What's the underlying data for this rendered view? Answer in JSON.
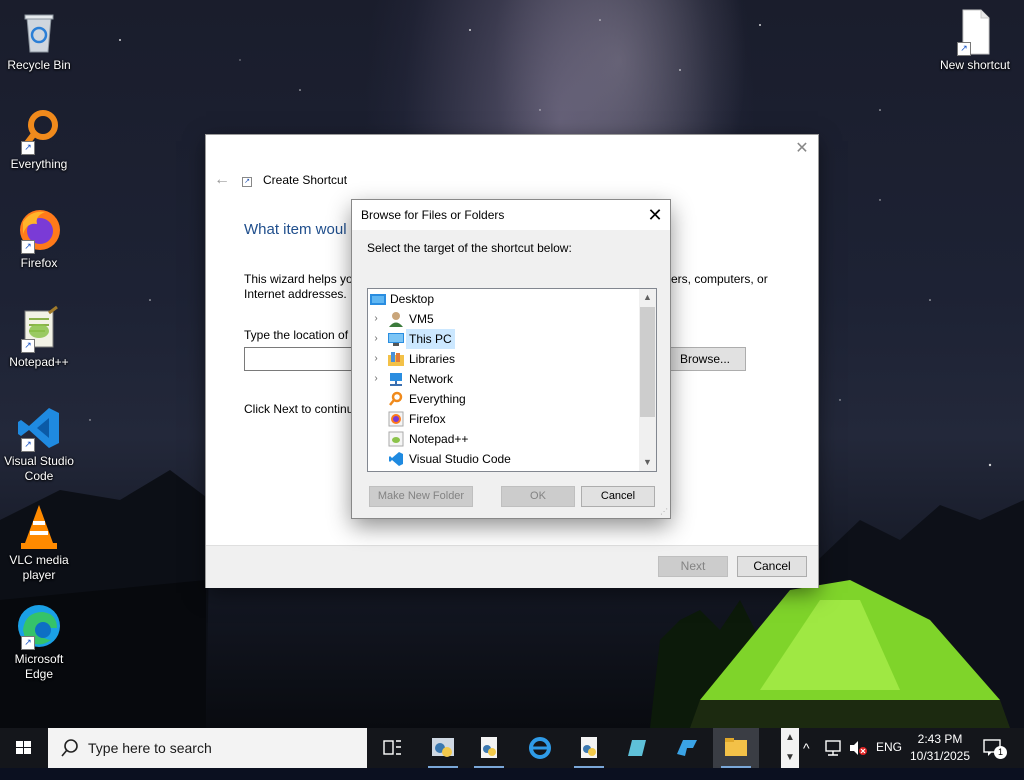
{
  "desktop": {
    "icons": [
      {
        "label": "Recycle Bin"
      },
      {
        "label": "Everything"
      },
      {
        "label": "Firefox"
      },
      {
        "label": "Notepad++"
      },
      {
        "label": "Visual Studio Code"
      },
      {
        "label": "VLC media player"
      },
      {
        "label": "Microsoft Edge"
      },
      {
        "label": "New shortcut"
      }
    ]
  },
  "wizard": {
    "title": "Create Shortcut",
    "heading": "What item woul",
    "description_left": "This wizard helps you",
    "description_right": "ers, computers, or",
    "description_line2": "Internet addresses.",
    "location_label": "Type the location of t",
    "location_value": "",
    "browse_label": "Browse...",
    "click_next": "Click Next to continu",
    "next_label": "Next",
    "cancel_label": "Cancel"
  },
  "browse_dialog": {
    "title": "Browse for Files or Folders",
    "prompt": "Select the target of the shortcut below:",
    "tree": [
      {
        "label": "Desktop",
        "icon": "desktop-folder-icon",
        "expandable": false
      },
      {
        "label": "VM5",
        "icon": "user-folder-icon",
        "expandable": true
      },
      {
        "label": "This PC",
        "icon": "this-pc-icon",
        "expandable": true,
        "selected": true
      },
      {
        "label": "Libraries",
        "icon": "libraries-icon",
        "expandable": true
      },
      {
        "label": "Network",
        "icon": "network-icon",
        "expandable": true
      },
      {
        "label": "Everything",
        "icon": "everything-icon",
        "expandable": false
      },
      {
        "label": "Firefox",
        "icon": "firefox-shortcut-icon",
        "expandable": false
      },
      {
        "label": "Notepad++",
        "icon": "notepadpp-shortcut-icon",
        "expandable": false
      },
      {
        "label": "Visual Studio Code",
        "icon": "vscode-shortcut-icon",
        "expandable": false
      }
    ],
    "make_new_folder_label": "Make New Folder",
    "ok_label": "OK",
    "cancel_label": "Cancel"
  },
  "taskbar": {
    "search_placeholder": "Type here to search",
    "language": "ENG",
    "time": "2:43 PM",
    "date": "10/31/2025",
    "notification_count": "1"
  }
}
